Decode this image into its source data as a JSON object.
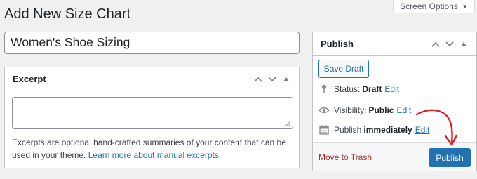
{
  "screen_options": {
    "label": "Screen Options"
  },
  "page": {
    "title": "Add New Size Chart"
  },
  "post_title": {
    "value": "Women's Shoe Sizing"
  },
  "excerpt": {
    "title": "Excerpt",
    "textarea_value": "",
    "help_text": "Excerpts are optional hand-crafted summaries of your content that can be used in your theme.",
    "help_link": "Learn more about manual excerpts",
    "help_suffix": "."
  },
  "publish": {
    "title": "Publish",
    "save_draft_label": "Save Draft",
    "status": {
      "label": "Status:",
      "value": "Draft",
      "edit": "Edit"
    },
    "visibility": {
      "label": "Visibility:",
      "value": "Public",
      "edit": "Edit"
    },
    "schedule": {
      "label": "Publish",
      "value": "immediately",
      "edit": "Edit"
    },
    "trash_label": "Move to Trash",
    "publish_label": "Publish"
  },
  "colors": {
    "accent": "#2271b1",
    "annotation_arrow": "#e11b22",
    "trash": "#b32d2e"
  },
  "icons": [
    "chevron-up-icon",
    "chevron-down-icon",
    "triangle-up-icon",
    "pin-icon",
    "eye-icon",
    "calendar-icon",
    "resize-grip-icon",
    "annotation-arrow"
  ]
}
